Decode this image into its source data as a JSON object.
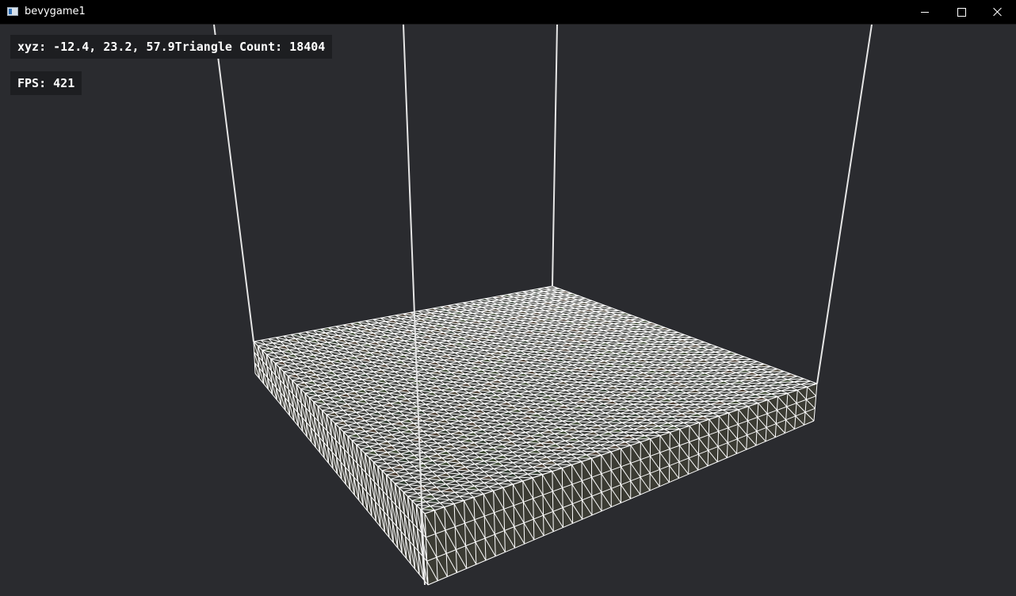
{
  "window": {
    "title": "bevygame1",
    "app_icon": "window-app-icon",
    "controls": {
      "minimize_icon": "minimize-icon",
      "maximize_icon": "maximize-icon",
      "close_icon": "close-icon"
    }
  },
  "hud": {
    "coords_text": "xyz: -12.4, 23.2, 57.9Triangle Count: 18404",
    "fps_text": "FPS: 421"
  },
  "scene": {
    "background_color": "#2a2b2f",
    "wireframe_color": "#ffffff",
    "face_tints": [
      "#3d4a33",
      "#4a4436",
      "#2f3b2f",
      "#4b3e32"
    ]
  }
}
